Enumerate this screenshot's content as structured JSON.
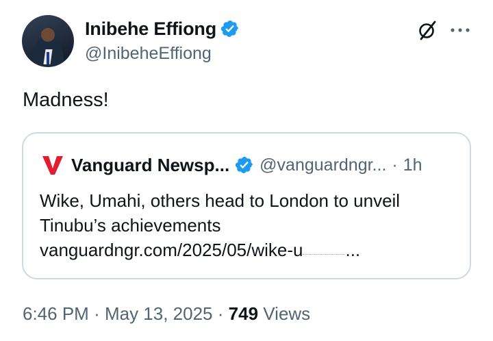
{
  "author": {
    "display_name": "Inibehe Effiong",
    "handle": "@InibeheEffiong"
  },
  "tweet": {
    "text": "Madness!"
  },
  "quoted": {
    "name": "Vanguard Newsp...",
    "handle": "@vanguardngr...",
    "separator": "·",
    "time": "1h",
    "text_line1": "Wike, Umahi, others head to London to unveil",
    "text_line2": "Tinubu’s achievements",
    "link_text": "vanguardngr.com/2025/05/wike-u",
    "link_ellipsis": "..."
  },
  "meta": {
    "time": "6:46 PM",
    "sep1": "·",
    "date": "May 13, 2025",
    "sep2": "·",
    "views_count": "749",
    "views_label": "Views"
  },
  "colors": {
    "verified": "#1d9bf0",
    "vanguard_red": "#e11d2e",
    "secondary_text": "#536471",
    "border": "#cfd9de"
  },
  "icons": [
    "verified-badge-icon",
    "grok-icon",
    "more-icon",
    "vanguard-logo-icon"
  ]
}
